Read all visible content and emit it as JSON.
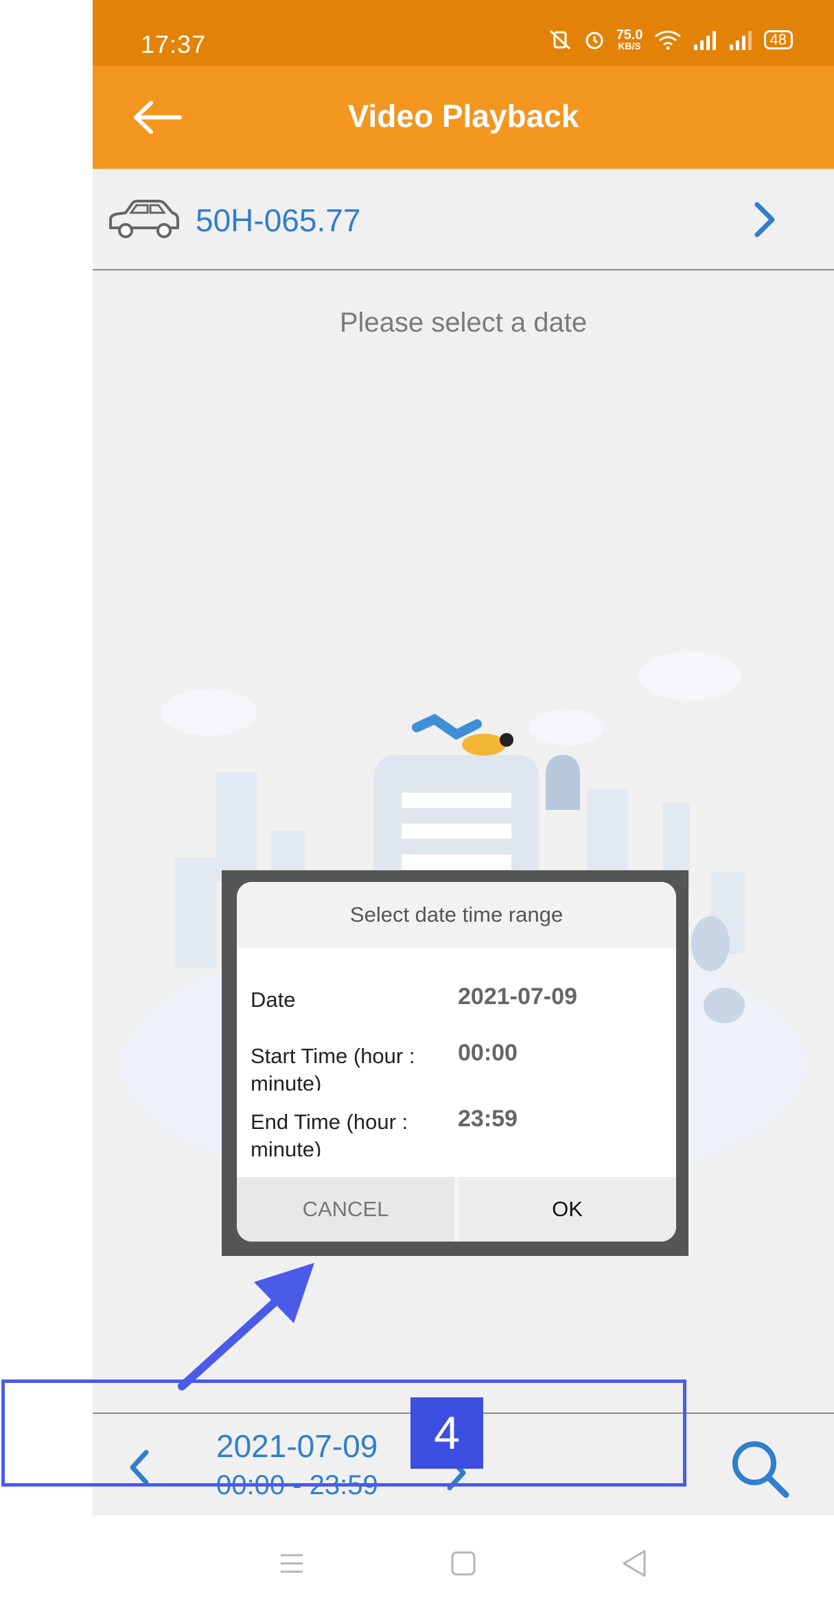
{
  "status_bar": {
    "time": "17:37",
    "speed_value": "75.0",
    "speed_unit": "KB/S",
    "battery": "48"
  },
  "app_bar": {
    "title": "Video Playback",
    "back_icon": "arrow-left-icon"
  },
  "vehicle": {
    "plate": "50H-065.77",
    "icon": "car-icon"
  },
  "content": {
    "hint": "Please select a date"
  },
  "dialog": {
    "title": "Select date time range",
    "rows": [
      {
        "label": "Date",
        "value": "2021-07-09"
      },
      {
        "label": "Start Time (hour : minute)",
        "value": "00:00"
      },
      {
        "label": "End Time (hour : minute)",
        "value": "23:59"
      }
    ],
    "cancel_label": "CANCEL",
    "ok_label": "OK"
  },
  "bottom_bar": {
    "date": "2021-07-09",
    "time_range": "00:00 - 23:59"
  },
  "annotation": {
    "badge": "4",
    "color": "#4a5be8"
  },
  "colors": {
    "status_bar": "#e28207",
    "app_bar": "#f29620",
    "accent_blue": "#2f7fcc"
  }
}
